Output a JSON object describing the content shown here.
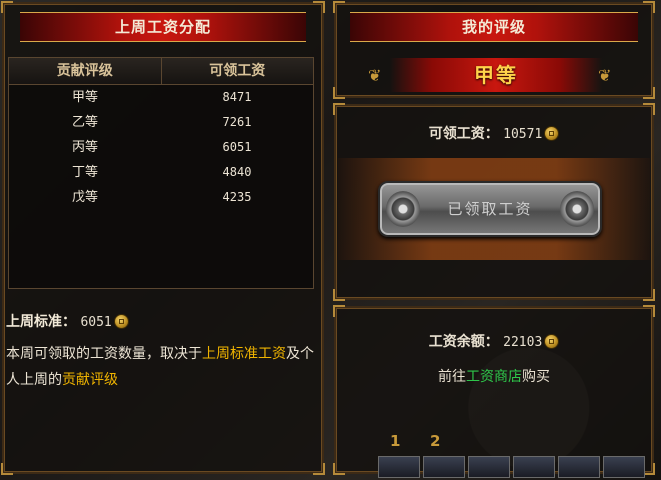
{
  "left_panel": {
    "title": "上周工资分配",
    "table": {
      "headers": [
        "贡献评级",
        "可领工资"
      ],
      "rows": [
        [
          "甲等",
          "8471"
        ],
        [
          "乙等",
          "7261"
        ],
        [
          "丙等",
          "6051"
        ],
        [
          "丁等",
          "4840"
        ],
        [
          "戊等",
          "4235"
        ]
      ]
    },
    "standard_label": "上周标准：",
    "standard_value": "6051",
    "desc_part1": "本周可领取的工资数量，取决于",
    "desc_link1": "上周标准工资",
    "desc_part2": "及个人上周的",
    "desc_link2": "贡献评级"
  },
  "right_panel": {
    "title": "我的评级",
    "rank": "甲等",
    "wage_label": "可领工资：",
    "wage_value": "10571",
    "claim_button_label": "已领取工资",
    "balance_label": "工资余额：",
    "balance_value": "22103",
    "goto_prefix": "前往",
    "goto_link": "工资商店",
    "goto_suffix": "购买"
  },
  "hotbar": {
    "slot_numbers": [
      "1",
      "2"
    ]
  },
  "colors": {
    "highlight": "#f0b400",
    "link": "#2ec64a",
    "rank": "#ffd24a",
    "banner": "#c8170f"
  },
  "icons": [
    "coin-icon",
    "flourish-left-icon",
    "flourish-right-icon"
  ]
}
